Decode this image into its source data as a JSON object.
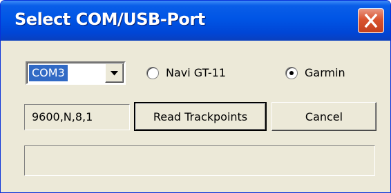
{
  "window": {
    "title": "Select COM/USB-Port"
  },
  "port": {
    "selected": "COM3"
  },
  "device": {
    "options": [
      {
        "label": "Navi GT-11",
        "selected": false
      },
      {
        "label": "Garmin",
        "selected": true
      }
    ]
  },
  "settings": {
    "baud": "9600,N,8,1"
  },
  "actions": {
    "read_label": "Read Trackpoints",
    "cancel_label": "Cancel"
  },
  "status": {
    "text": ""
  },
  "icons": {
    "close": "close-icon",
    "dropdown": "chevron-down-icon"
  },
  "colors": {
    "title_bar": "#0055e5",
    "close_button": "#d9532f",
    "face": "#ece9d8",
    "selection": "#316ac5"
  }
}
